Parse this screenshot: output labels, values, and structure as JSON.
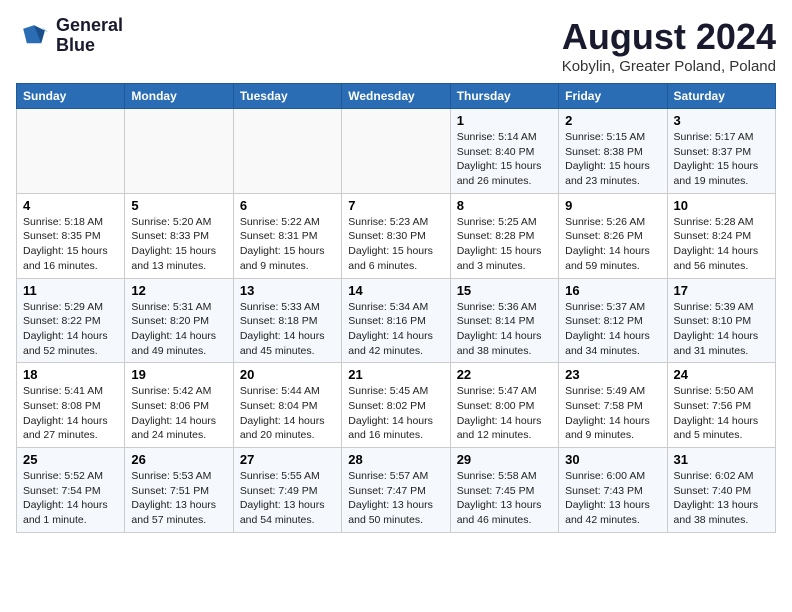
{
  "logo": {
    "line1": "General",
    "line2": "Blue"
  },
  "title": "August 2024",
  "location": "Kobylin, Greater Poland, Poland",
  "headers": [
    "Sunday",
    "Monday",
    "Tuesday",
    "Wednesday",
    "Thursday",
    "Friday",
    "Saturday"
  ],
  "weeks": [
    [
      {
        "day": "",
        "info": ""
      },
      {
        "day": "",
        "info": ""
      },
      {
        "day": "",
        "info": ""
      },
      {
        "day": "",
        "info": ""
      },
      {
        "day": "1",
        "info": "Sunrise: 5:14 AM\nSunset: 8:40 PM\nDaylight: 15 hours\nand 26 minutes."
      },
      {
        "day": "2",
        "info": "Sunrise: 5:15 AM\nSunset: 8:38 PM\nDaylight: 15 hours\nand 23 minutes."
      },
      {
        "day": "3",
        "info": "Sunrise: 5:17 AM\nSunset: 8:37 PM\nDaylight: 15 hours\nand 19 minutes."
      }
    ],
    [
      {
        "day": "4",
        "info": "Sunrise: 5:18 AM\nSunset: 8:35 PM\nDaylight: 15 hours\nand 16 minutes."
      },
      {
        "day": "5",
        "info": "Sunrise: 5:20 AM\nSunset: 8:33 PM\nDaylight: 15 hours\nand 13 minutes."
      },
      {
        "day": "6",
        "info": "Sunrise: 5:22 AM\nSunset: 8:31 PM\nDaylight: 15 hours\nand 9 minutes."
      },
      {
        "day": "7",
        "info": "Sunrise: 5:23 AM\nSunset: 8:30 PM\nDaylight: 15 hours\nand 6 minutes."
      },
      {
        "day": "8",
        "info": "Sunrise: 5:25 AM\nSunset: 8:28 PM\nDaylight: 15 hours\nand 3 minutes."
      },
      {
        "day": "9",
        "info": "Sunrise: 5:26 AM\nSunset: 8:26 PM\nDaylight: 14 hours\nand 59 minutes."
      },
      {
        "day": "10",
        "info": "Sunrise: 5:28 AM\nSunset: 8:24 PM\nDaylight: 14 hours\nand 56 minutes."
      }
    ],
    [
      {
        "day": "11",
        "info": "Sunrise: 5:29 AM\nSunset: 8:22 PM\nDaylight: 14 hours\nand 52 minutes."
      },
      {
        "day": "12",
        "info": "Sunrise: 5:31 AM\nSunset: 8:20 PM\nDaylight: 14 hours\nand 49 minutes."
      },
      {
        "day": "13",
        "info": "Sunrise: 5:33 AM\nSunset: 8:18 PM\nDaylight: 14 hours\nand 45 minutes."
      },
      {
        "day": "14",
        "info": "Sunrise: 5:34 AM\nSunset: 8:16 PM\nDaylight: 14 hours\nand 42 minutes."
      },
      {
        "day": "15",
        "info": "Sunrise: 5:36 AM\nSunset: 8:14 PM\nDaylight: 14 hours\nand 38 minutes."
      },
      {
        "day": "16",
        "info": "Sunrise: 5:37 AM\nSunset: 8:12 PM\nDaylight: 14 hours\nand 34 minutes."
      },
      {
        "day": "17",
        "info": "Sunrise: 5:39 AM\nSunset: 8:10 PM\nDaylight: 14 hours\nand 31 minutes."
      }
    ],
    [
      {
        "day": "18",
        "info": "Sunrise: 5:41 AM\nSunset: 8:08 PM\nDaylight: 14 hours\nand 27 minutes."
      },
      {
        "day": "19",
        "info": "Sunrise: 5:42 AM\nSunset: 8:06 PM\nDaylight: 14 hours\nand 24 minutes."
      },
      {
        "day": "20",
        "info": "Sunrise: 5:44 AM\nSunset: 8:04 PM\nDaylight: 14 hours\nand 20 minutes."
      },
      {
        "day": "21",
        "info": "Sunrise: 5:45 AM\nSunset: 8:02 PM\nDaylight: 14 hours\nand 16 minutes."
      },
      {
        "day": "22",
        "info": "Sunrise: 5:47 AM\nSunset: 8:00 PM\nDaylight: 14 hours\nand 12 minutes."
      },
      {
        "day": "23",
        "info": "Sunrise: 5:49 AM\nSunset: 7:58 PM\nDaylight: 14 hours\nand 9 minutes."
      },
      {
        "day": "24",
        "info": "Sunrise: 5:50 AM\nSunset: 7:56 PM\nDaylight: 14 hours\nand 5 minutes."
      }
    ],
    [
      {
        "day": "25",
        "info": "Sunrise: 5:52 AM\nSunset: 7:54 PM\nDaylight: 14 hours\nand 1 minute."
      },
      {
        "day": "26",
        "info": "Sunrise: 5:53 AM\nSunset: 7:51 PM\nDaylight: 13 hours\nand 57 minutes."
      },
      {
        "day": "27",
        "info": "Sunrise: 5:55 AM\nSunset: 7:49 PM\nDaylight: 13 hours\nand 54 minutes."
      },
      {
        "day": "28",
        "info": "Sunrise: 5:57 AM\nSunset: 7:47 PM\nDaylight: 13 hours\nand 50 minutes."
      },
      {
        "day": "29",
        "info": "Sunrise: 5:58 AM\nSunset: 7:45 PM\nDaylight: 13 hours\nand 46 minutes."
      },
      {
        "day": "30",
        "info": "Sunrise: 6:00 AM\nSunset: 7:43 PM\nDaylight: 13 hours\nand 42 minutes."
      },
      {
        "day": "31",
        "info": "Sunrise: 6:02 AM\nSunset: 7:40 PM\nDaylight: 13 hours\nand 38 minutes."
      }
    ]
  ]
}
